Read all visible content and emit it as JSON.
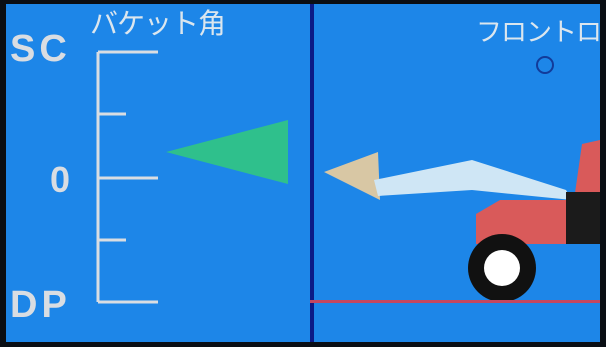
{
  "bucket_panel": {
    "title": "バケット角",
    "labels": {
      "top": "SC",
      "middle": "0",
      "bottom": "DP"
    }
  },
  "loader_panel": {
    "title": "フロントローダ"
  },
  "colors": {
    "background": "#1d86e8",
    "indicator": "#2fc08c",
    "bucket": "#d8c7a4",
    "tractor": "#d95a5a"
  }
}
